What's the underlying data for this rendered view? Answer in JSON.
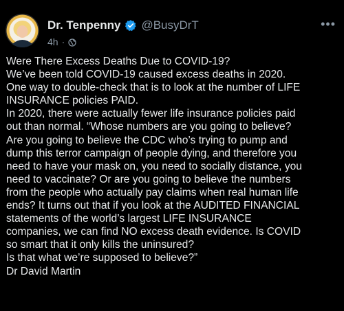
{
  "author": {
    "name": "Dr. Tenpenny",
    "handle": "@BusyDrT",
    "time": "4h",
    "separator": "·",
    "avatar_icon": "profile-photo",
    "verified_icon": "verified-badge-icon",
    "visibility_icon": "globe-icon",
    "verified_color": "#1d9bf0"
  },
  "more_label": "•••",
  "post": {
    "lines": [
      "Were There Excess Deaths Due to COVID-19?",
      "We’ve been told COVID-19 caused excess deaths in 2020.",
      "One way to double-check that is to look at the number of LIFE",
      "INSURANCE policies PAID.",
      "In 2020, there were actually fewer life insurance policies paid",
      "out than normal. “Whose numbers are you going to believe?",
      "Are you going to believe the CDC who’s trying to pump and",
      "dump this terror campaign of people dying, and therefore you",
      "need to have your mask on, you need to socially distance, you",
      "need to vaccinate? Or are you going to believe the numbers",
      "from the people who actually pay claims when real human life",
      "ends? It turns out that if you look at the AUDITED FINANCIAL",
      "statements of the world’s largest LIFE INSURANCE",
      "companies, we can find NO excess death evidence. Is COVID",
      "so smart that it only kills the uninsured?",
      "Is that what we’re supposed to believe?”",
      "Dr David Martin"
    ]
  }
}
